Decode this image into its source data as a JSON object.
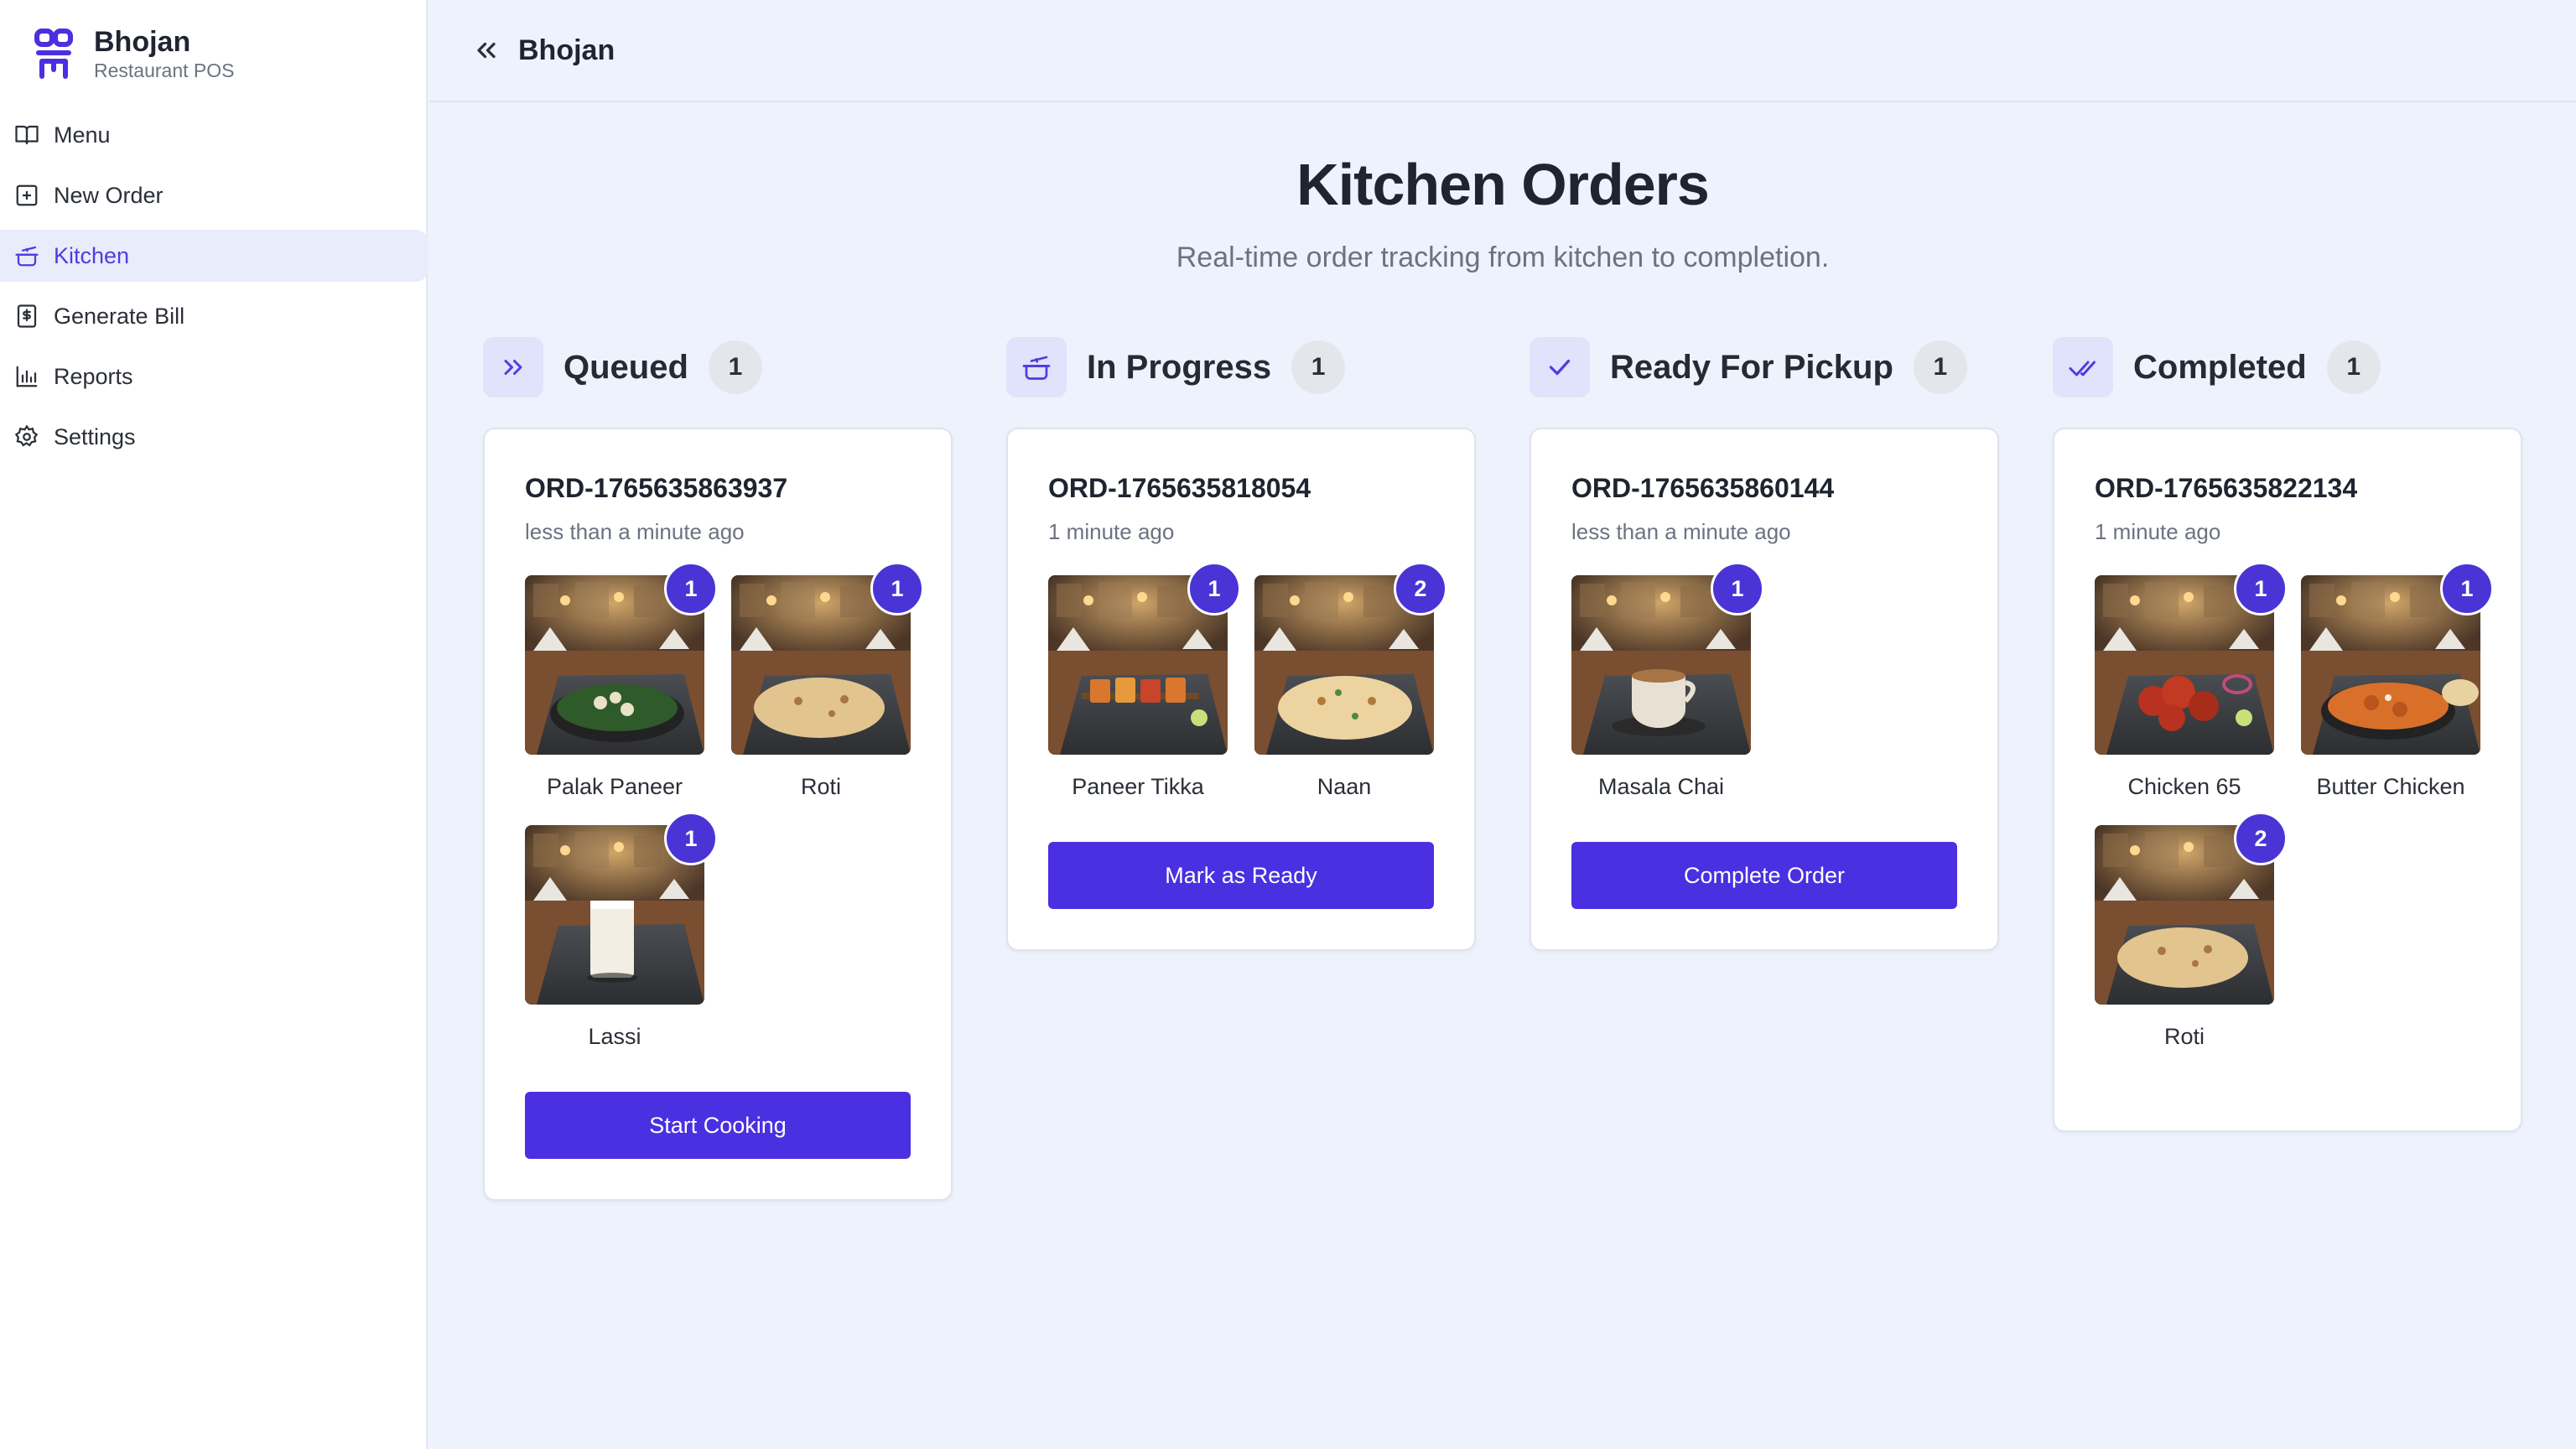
{
  "brand": {
    "name": "Bhojan",
    "subtitle": "Restaurant POS"
  },
  "nav": [
    {
      "label": "Menu",
      "icon": "book-icon",
      "active": false
    },
    {
      "label": "New Order",
      "icon": "plus-square-icon",
      "active": false
    },
    {
      "label": "Kitchen",
      "icon": "cooking-pot-icon",
      "active": true
    },
    {
      "label": "Generate Bill",
      "icon": "receipt-icon",
      "active": false
    },
    {
      "label": "Reports",
      "icon": "bar-chart-icon",
      "active": false
    },
    {
      "label": "Settings",
      "icon": "gear-icon",
      "active": false
    }
  ],
  "topbar": {
    "title": "Bhojan",
    "collapse_icon": "chevrons-left-icon"
  },
  "header": {
    "title": "Kitchen Orders",
    "subtitle": "Real-time order tracking from kitchen to completion."
  },
  "colors": {
    "accent": "#4a30e0",
    "badge": "#4a34d6",
    "active_nav_bg": "#e8ecfb",
    "page_bg": "#eef2fc"
  },
  "columns": [
    {
      "title": "Queued",
      "count": "1",
      "icon": "chevrons-right-icon",
      "order": {
        "id": "ORD-1765635863937",
        "time": "less than a minute ago",
        "items": [
          {
            "name": "Palak Paneer",
            "qty": "1"
          },
          {
            "name": "Roti",
            "qty": "1"
          },
          {
            "name": "Lassi",
            "qty": "1"
          }
        ],
        "action": "Start Cooking"
      }
    },
    {
      "title": "In Progress",
      "count": "1",
      "icon": "cooking-pot-icon",
      "order": {
        "id": "ORD-1765635818054",
        "time": "1 minute ago",
        "items": [
          {
            "name": "Paneer Tikka",
            "qty": "1"
          },
          {
            "name": "Naan",
            "qty": "2"
          }
        ],
        "action": "Mark as Ready"
      }
    },
    {
      "title": "Ready For Pickup",
      "count": "1",
      "icon": "check-icon",
      "order": {
        "id": "ORD-1765635860144",
        "time": "less than a minute ago",
        "items": [
          {
            "name": "Masala Chai",
            "qty": "1"
          }
        ],
        "action": "Complete Order"
      }
    },
    {
      "title": "Completed",
      "count": "1",
      "icon": "double-check-icon",
      "order": {
        "id": "ORD-1765635822134",
        "time": "1 minute ago",
        "items": [
          {
            "name": "Chicken 65",
            "qty": "1"
          },
          {
            "name": "Butter Chicken",
            "qty": "1"
          },
          {
            "name": "Roti",
            "qty": "2"
          }
        ],
        "action": ""
      }
    }
  ]
}
